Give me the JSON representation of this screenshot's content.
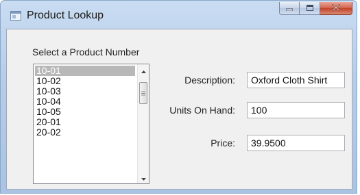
{
  "window": {
    "title": "Product Lookup",
    "icons": {
      "app": "window-app-icon",
      "minimize": "minimize-icon",
      "maximize": "maximize-icon",
      "close": "close-icon"
    }
  },
  "form": {
    "list_label": "Select a Product Number",
    "products": [
      "10-01",
      "10-02",
      "10-03",
      "10-04",
      "10-05",
      "20-01",
      "20-02"
    ],
    "selected_index": 0,
    "description_label": "Description:",
    "description_value": "Oxford Cloth Shirt",
    "units_label": "Units On Hand:",
    "units_value": "100",
    "price_label": "Price:",
    "price_value": "39.9500"
  },
  "colors": {
    "selection": "#b8b8b8",
    "close_button": "#c1432a"
  }
}
